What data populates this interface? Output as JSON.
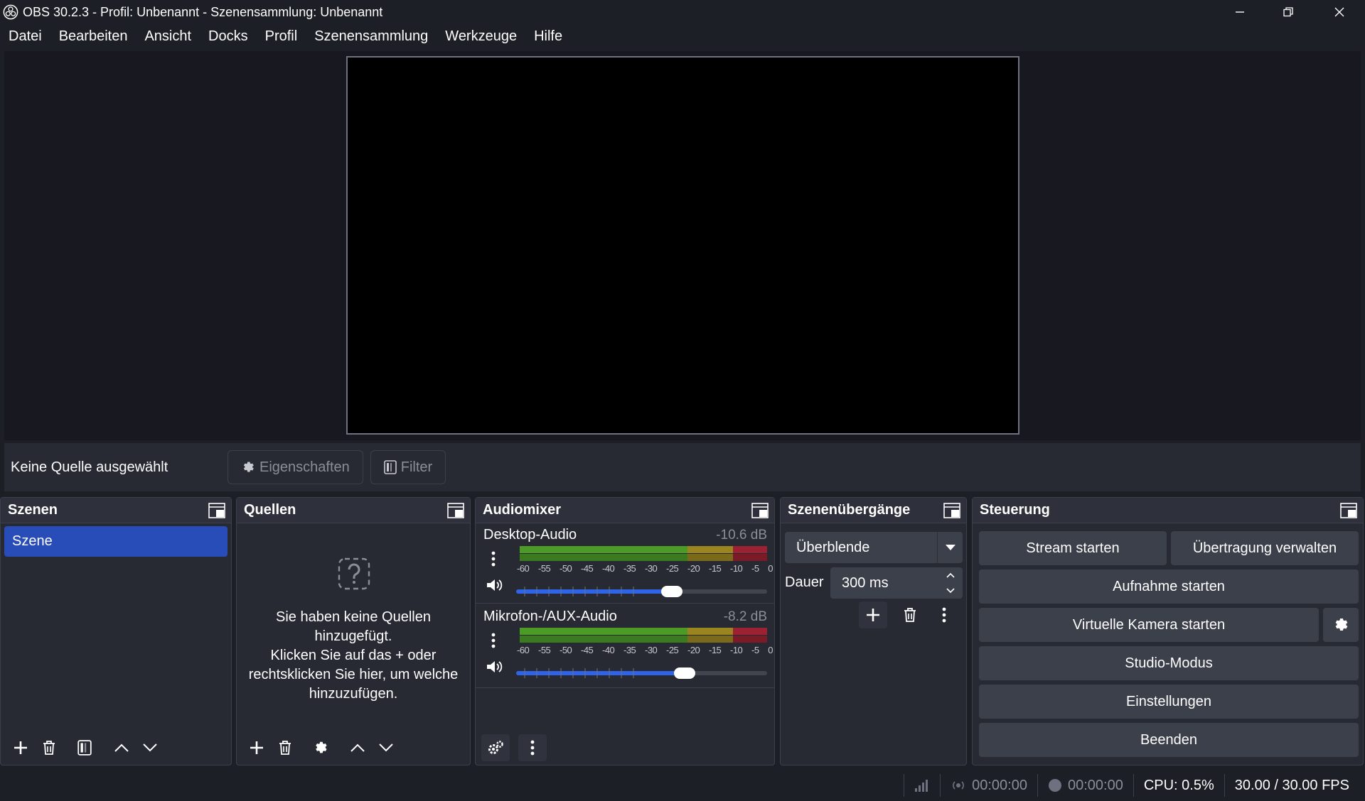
{
  "window": {
    "title": "OBS 30.2.3 - Profil: Unbenannt - Szenensammlung: Unbenannt"
  },
  "menu": [
    "Datei",
    "Bearbeiten",
    "Ansicht",
    "Docks",
    "Profil",
    "Szenensammlung",
    "Werkzeuge",
    "Hilfe"
  ],
  "context": {
    "no_source": "Keine Quelle ausgewählt",
    "properties": "Eigenschaften",
    "filters": "Filter"
  },
  "scenes": {
    "title": "Szenen",
    "items": [
      "Szene"
    ]
  },
  "sources": {
    "title": "Quellen",
    "empty_line1": "Sie haben keine Quellen hinzugefügt.",
    "empty_line2": "Klicken Sie auf das + oder rechtsklicken Sie hier, um welche hinzuzufügen."
  },
  "mixer": {
    "title": "Audiomixer",
    "scale": [
      "-60",
      "-55",
      "-50",
      "-45",
      "-40",
      "-35",
      "-30",
      "-25",
      "-20",
      "-15",
      "-10",
      "-5",
      "0"
    ],
    "channels": [
      {
        "name": "Desktop-Audio",
        "db": "-10.6 dB",
        "volume": 0.62
      },
      {
        "name": "Mikrofon-/AUX-Audio",
        "db": "-8.2 dB",
        "volume": 0.67
      }
    ]
  },
  "transitions": {
    "title": "Szenenübergänge",
    "selected": "Überblende",
    "duration_label": "Dauer",
    "duration_value": "300 ms"
  },
  "controls": {
    "title": "Steuerung",
    "stream": "Stream starten",
    "manage": "Übertragung verwalten",
    "record": "Aufnahme starten",
    "virtualcam": "Virtuelle Kamera starten",
    "studio": "Studio-Modus",
    "settings": "Einstellungen",
    "exit": "Beenden"
  },
  "status": {
    "stream_time": "00:00:00",
    "record_time": "00:00:00",
    "cpu": "CPU: 0.5%",
    "fps": "30.00 / 30.00 FPS"
  },
  "colors": {
    "background": "#1d1f26",
    "panel": "#272a33",
    "accent": "#284cb8",
    "slider": "#2f63e8",
    "meter_green": "#4b9b26",
    "meter_yellow": "#9a8520",
    "meter_red": "#9c2233"
  }
}
